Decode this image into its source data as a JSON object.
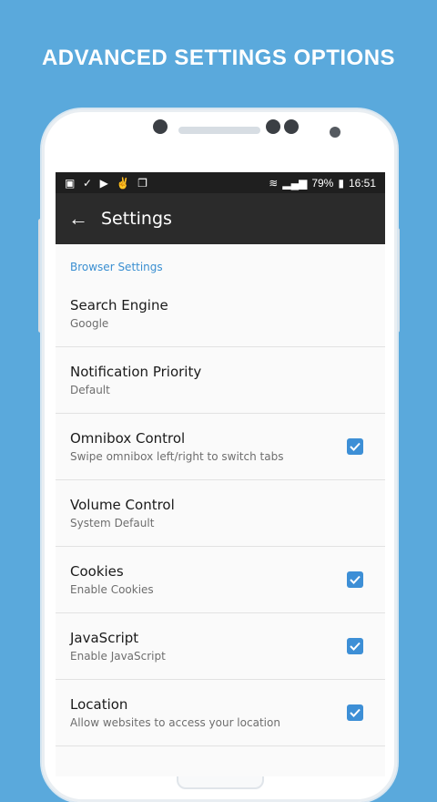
{
  "headline": "ADVANCED SETTINGS OPTIONS",
  "status_bar": {
    "left_icons": [
      "image-icon",
      "check-icon",
      "youtube-icon",
      "hand-icon",
      "copy-icon"
    ],
    "signal": "79%",
    "time": "16:51"
  },
  "app_bar": {
    "title": "Settings"
  },
  "section": {
    "title": "Browser Settings"
  },
  "settings": [
    {
      "title": "Search Engine",
      "subtitle": "Google",
      "checked": null
    },
    {
      "title": "Notification Priority",
      "subtitle": "Default",
      "checked": null
    },
    {
      "title": "Omnibox Control",
      "subtitle": "Swipe omnibox left/right to switch tabs",
      "checked": true
    },
    {
      "title": "Volume Control",
      "subtitle": "System Default",
      "checked": null
    },
    {
      "title": "Cookies",
      "subtitle": "Enable Cookies",
      "checked": true
    },
    {
      "title": "JavaScript",
      "subtitle": "Enable JavaScript",
      "checked": true
    },
    {
      "title": "Location",
      "subtitle": "Allow websites to access your location",
      "checked": true
    }
  ],
  "colors": {
    "background": "#5aa9dc",
    "accent": "#3d8fd6",
    "appbar": "#2b2b2b"
  }
}
